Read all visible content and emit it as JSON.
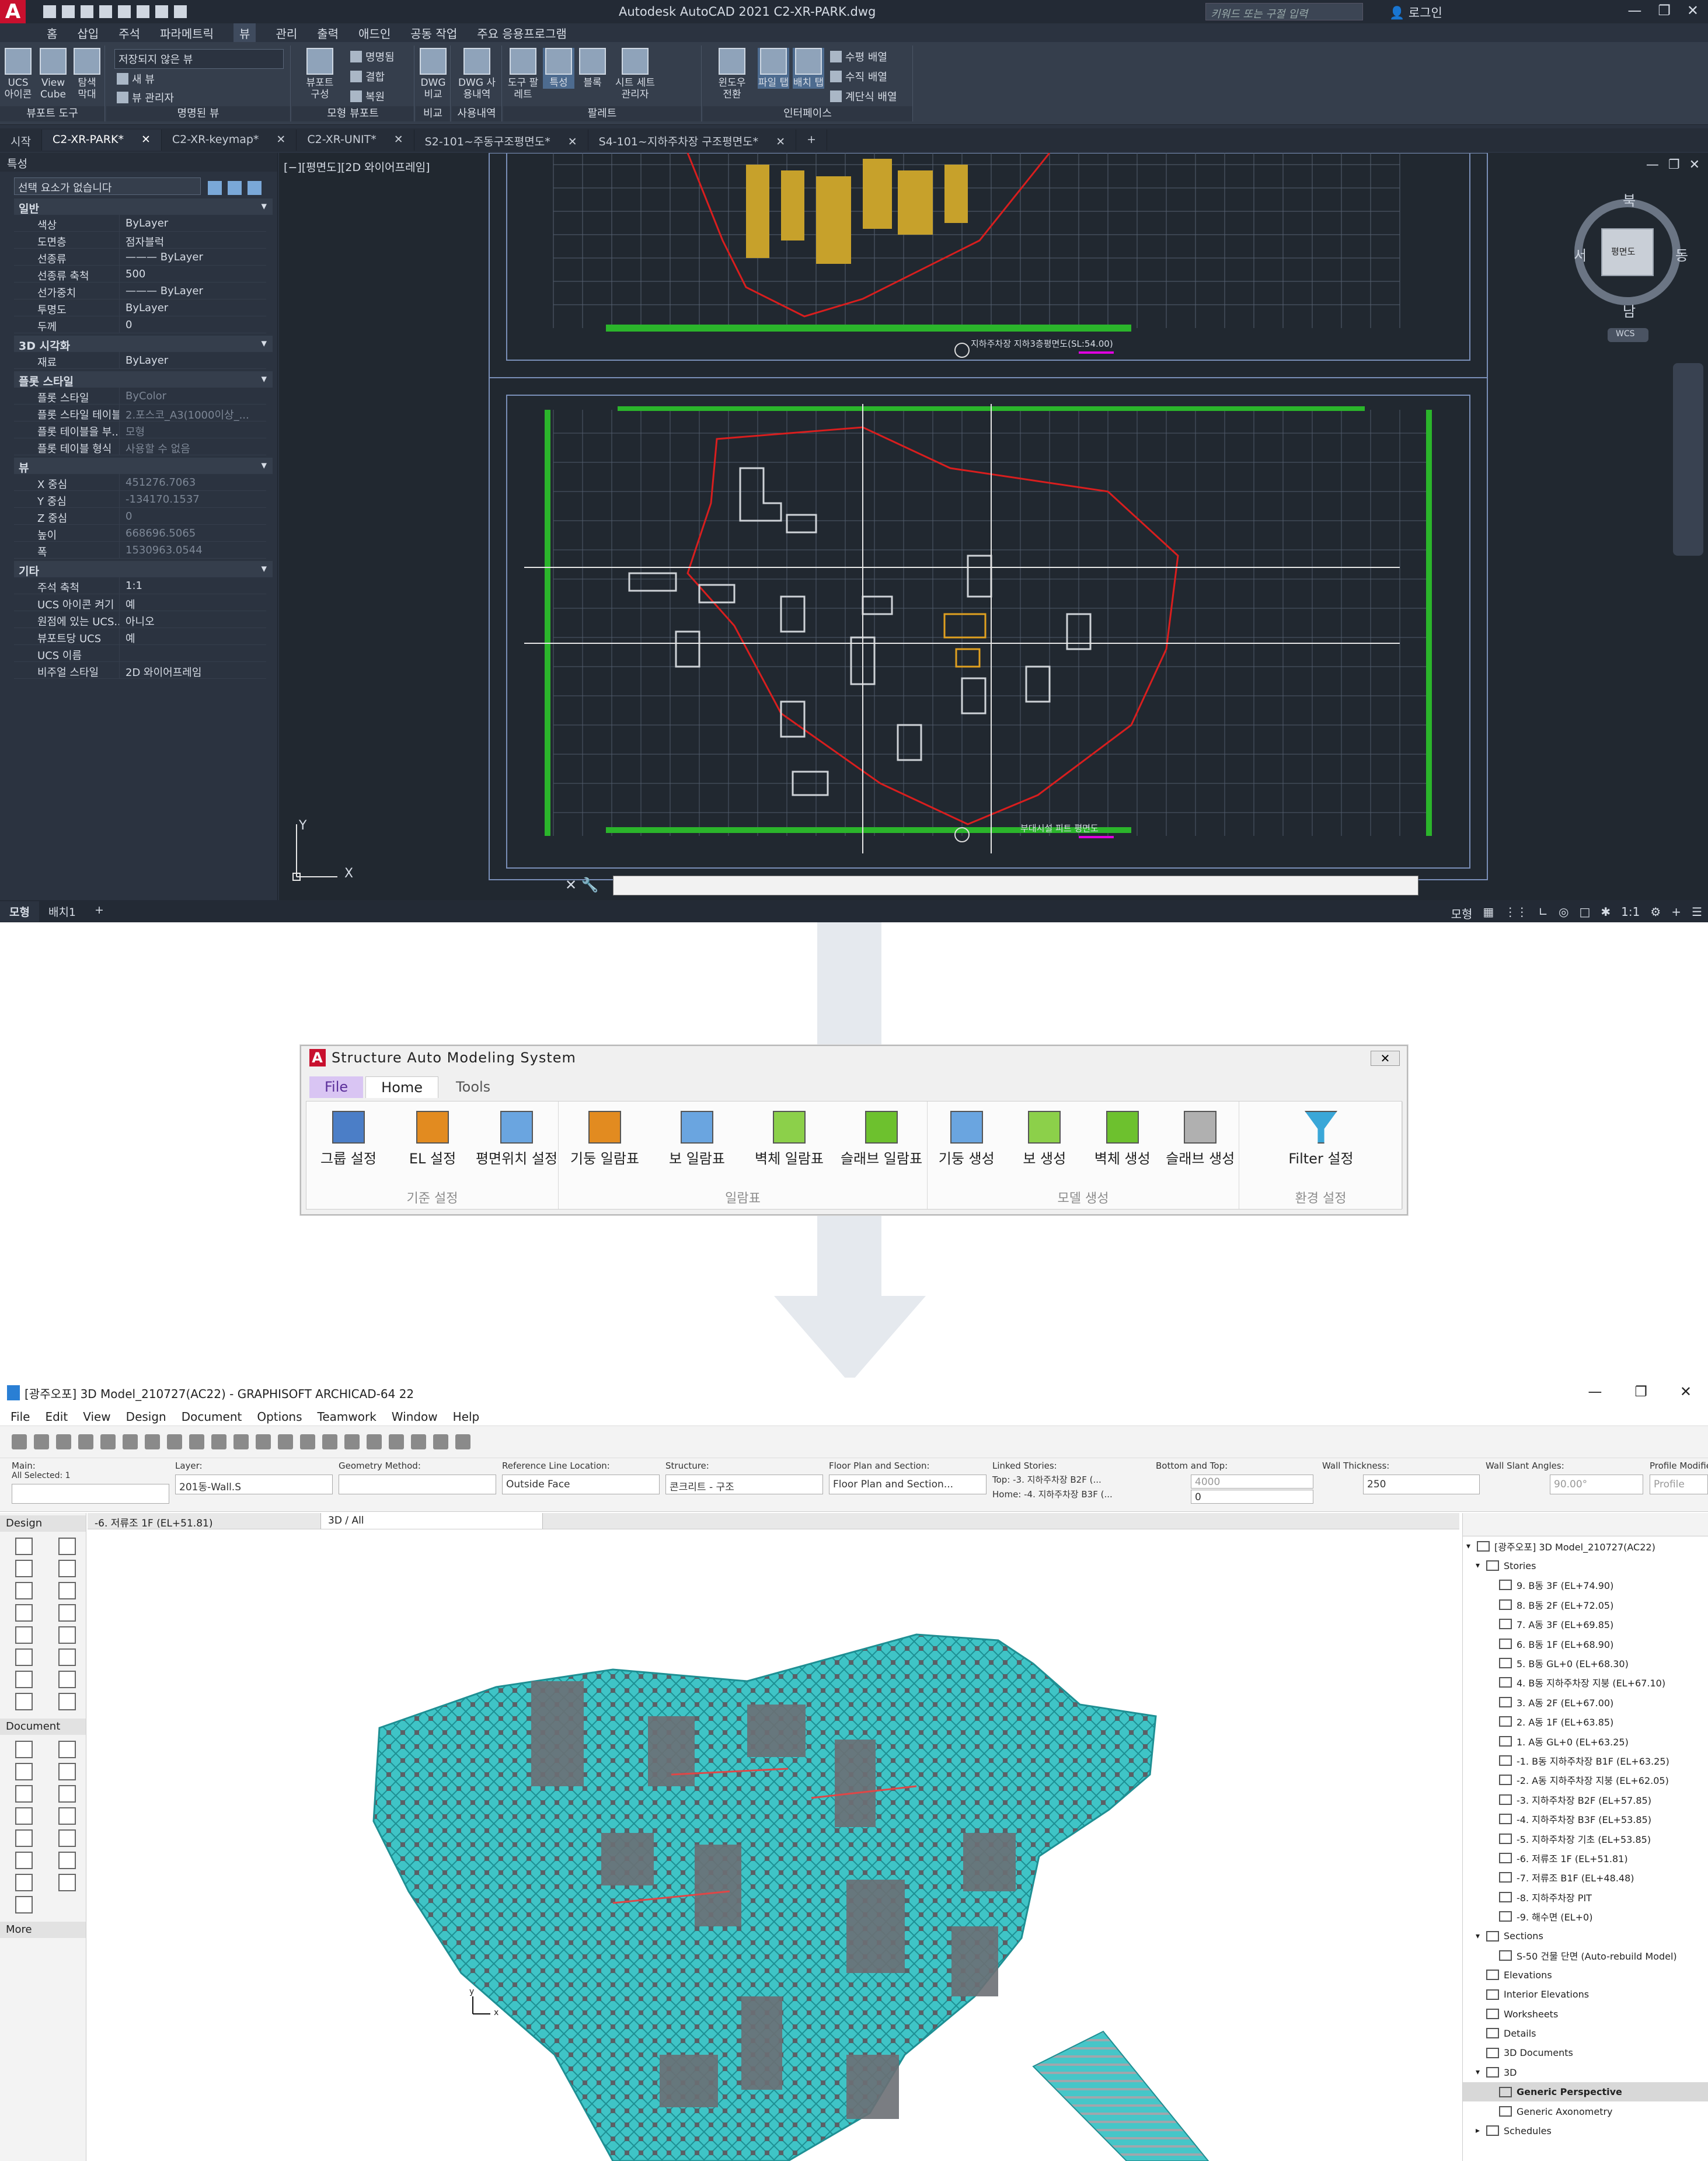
{
  "autocad": {
    "window_title": "Autodesk AutoCAD 2021    C2-XR-PARK.dwg",
    "search_placeholder": "키워드 또는 구절 입력",
    "login_label": "로그인",
    "menu_tabs": [
      "홈",
      "삽입",
      "주석",
      "파라메트릭",
      "뷰",
      "관리",
      "출력",
      "애드인",
      "공동 작업",
      "주요 응용프로그램"
    ],
    "active_menu_tab": "뷰",
    "ribbon": {
      "g1_label": "뷰포트 도구",
      "ucs_icon_btn": "UCS 아이콘",
      "viewcube_btn": "View Cube",
      "nav_bar_btn": "탐색 막대",
      "g2_label": "명명된 뷰",
      "view_dropdown": "저장되지 않은 뷰",
      "new_view": "새 뷰",
      "view_manager": "뷰 관리자",
      "g3_label": "모형 뷰포트",
      "viewport_config": "뷰포트 구성",
      "named": "명명됨",
      "join": "결합",
      "restore": "복원",
      "g4_label": "비교",
      "dwg_compare": "DWG 비교",
      "g5_label": "사용내역",
      "dwg_history": "DWG 사용내역",
      "g6_label": "팔레트",
      "tool_palette": "도구 팔레트",
      "properties_btn": "특성",
      "block_btn": "블록",
      "sheetset_btn": "시트 세트 관리자",
      "g7_label": "인터페이스",
      "switch_window": "윈도우 전환",
      "file_tabs": "파일 탭",
      "layout_tabs": "배치 탭",
      "tile_h": "수평 배열",
      "tile_v": "수직 배열",
      "cascade": "계단식 배열"
    },
    "doc_tabs": [
      {
        "label": "시작",
        "close": ""
      },
      {
        "label": "C2-XR-PARK*",
        "close": "✕"
      },
      {
        "label": "C2-XR-keymap*",
        "close": "✕"
      },
      {
        "label": "C2-XR-UNIT*",
        "close": "✕"
      },
      {
        "label": "S2-101~주동구조평면도*",
        "close": "✕"
      },
      {
        "label": "S4-101~지하주차장 구조평면도*",
        "close": "✕"
      }
    ],
    "properties_panel": {
      "title": "특성",
      "selection": "선택 요소가 없습니다",
      "sections": [
        {
          "name": "일반",
          "rows": [
            [
              "색상",
              "ByLayer"
            ],
            [
              "도면층",
              "점자블럭"
            ],
            [
              "선종류",
              "——— ByLayer"
            ],
            [
              "선종류 축척",
              "500"
            ],
            [
              "선가중치",
              "——— ByLayer"
            ],
            [
              "투명도",
              "ByLayer"
            ],
            [
              "두께",
              "0"
            ]
          ]
        },
        {
          "name": "3D 시각화",
          "rows": [
            [
              "재료",
              "ByLayer"
            ]
          ]
        },
        {
          "name": "플롯 스타일",
          "rows": [
            [
              "플롯 스타일",
              "ByColor"
            ],
            [
              "플롯 스타일 테이블",
              "2.포스코_A3(1000이상_..."
            ],
            [
              "플롯 테이블을 부...",
              "모형"
            ],
            [
              "플롯 테이블 형식",
              "사용할 수 없음"
            ]
          ]
        },
        {
          "name": "뷰",
          "rows": [
            [
              "X 중심",
              "451276.7063"
            ],
            [
              "Y 중심",
              "-134170.1537"
            ],
            [
              "Z 중심",
              "0"
            ],
            [
              "높이",
              "668696.5065"
            ],
            [
              "폭",
              "1530963.0544"
            ]
          ]
        },
        {
          "name": "기타",
          "rows": [
            [
              "주석 축척",
              "1:1"
            ],
            [
              "UCS 아이콘 켜기",
              "예"
            ],
            [
              "원점에 있는 UCS...",
              "아니오"
            ],
            [
              "뷰포트당 UCS",
              "예"
            ],
            [
              "UCS 이름",
              ""
            ],
            [
              "비주얼 스타일",
              "2D 와이어프레임"
            ]
          ]
        }
      ]
    },
    "viewport_label": "[−][평면도][2D 와이어프레임]",
    "viewcube": {
      "north": "북",
      "south": "남",
      "east": "동",
      "west": "서",
      "face": "평면도",
      "wcs": "WCS"
    },
    "drawing_label_1": "지하주차장 지하3층평면도(SL:54.00)",
    "drawing_label_2": "부대시설 피트 평면도",
    "ucs_x": "X",
    "ucs_y": "Y",
    "layout_tabs": [
      "모형",
      "배치1",
      "+"
    ],
    "status_model": "모형",
    "status_scale": "1:1"
  },
  "sams": {
    "title": "Structure Auto Modeling System",
    "close": "✕",
    "tabs": [
      "File",
      "Home",
      "Tools"
    ],
    "active_tab": "Home",
    "groups": [
      {
        "label": "기준 설정",
        "buttons": [
          "그룹 설정",
          "EL 설정",
          "평면위치 설정"
        ]
      },
      {
        "label": "일람표",
        "buttons": [
          "기둥 일람표",
          "보 일람표",
          "벽체 일람표",
          "슬래브 일람표"
        ]
      },
      {
        "label": "모델 생성",
        "buttons": [
          "기둥 생성",
          "보 생성",
          "벽체 생성",
          "슬래브 생성"
        ]
      },
      {
        "label": "환경 설정",
        "buttons": [
          "Filter 설정"
        ]
      }
    ]
  },
  "archicad": {
    "window_title": "[광주오포] 3D Model_210727(AC22) - GRAPHISOFT ARCHICAD-64 22",
    "menus": [
      "File",
      "Edit",
      "View",
      "Design",
      "Document",
      "Options",
      "Teamwork",
      "Window",
      "Help"
    ],
    "info_fields": {
      "main_label": "Main:",
      "all_selected": "All Selected: 1",
      "layer_label": "Layer:",
      "layer_value": "201동-Wall.S",
      "geometry_label": "Geometry Method:",
      "refline_label": "Reference Line Location:",
      "refline_value": "Outside Face",
      "structure_label": "Structure:",
      "structure_value": "콘크리트 - 구조",
      "floorplan_label": "Floor Plan and Section:",
      "floorplan_value": "Floor Plan and Section...",
      "linked_label": "Linked Stories:",
      "top_value": "Top:  -3. 지하주차장 B2F (...",
      "home_value": "Home:  -4. 지하주차장 B3F (...",
      "bottomtop_label": "Bottom and Top:",
      "top_height": "4000",
      "bottom_height": "0",
      "thickness_label": "Wall Thickness:",
      "thickness_value": "250",
      "slant_label": "Wall Slant Angles:",
      "slant_value": "90.00°",
      "profile_label": "Profile Modifier",
      "profile_value": "Profile"
    },
    "view_tabs": [
      "-6. 저류조 1F (EL+51.81)",
      "3D / All"
    ],
    "toolbox": {
      "design": "Design",
      "document": "Document",
      "more": "More"
    },
    "navigator": {
      "root": "[광주오포] 3D Model_210727(AC22)",
      "stories_label": "Stories",
      "stories": [
        "9. B동 3F (EL+74.90)",
        "8. B동 2F (EL+72.05)",
        "7. A동 3F (EL+69.85)",
        "6. B동 1F (EL+68.90)",
        "5. B동 GL+0 (EL+68.30)",
        "4. B동 지하주차장 지붕 (EL+67.10)",
        "3. A동 2F (EL+67.00)",
        "2. A동 1F (EL+63.85)",
        "1. A동 GL+0 (EL+63.25)",
        "-1. B동 지하주차장 B1F (EL+63.25)",
        "-2. A동 지하주차장 지붕 (EL+62.05)",
        "-3. 지하주차장 B2F (EL+57.85)",
        "-4. 지하주차장 B3F (EL+53.85)",
        "-5. 지하주차장 기초 (EL+53.85)",
        "-6. 저류조 1F (EL+51.81)",
        "-7. 저류조 B1F (EL+48.48)",
        "-8. 지하주차장 PIT",
        "-9. 해수면 (EL+0)"
      ],
      "sections_label": "Sections",
      "section_item": "S-50 건물 단면 (Auto-rebuild Model)",
      "others": [
        "Elevations",
        "Interior Elevations",
        "Worksheets",
        "Details",
        "3D Documents"
      ],
      "threed_label": "3D",
      "threed_items": [
        "Generic Perspective",
        "Generic Axonometry"
      ],
      "selected_item": "Generic Perspective",
      "schedules": "Schedules"
    },
    "axis_x": "x",
    "axis_y": "y"
  }
}
